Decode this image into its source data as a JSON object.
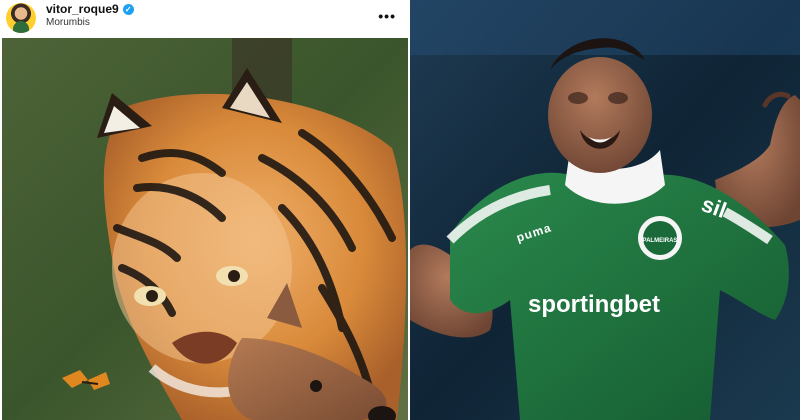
{
  "post": {
    "username": "vitor_roque9",
    "location": "Morumbis",
    "menu_icon": "more-horizontal-icon",
    "verified_icon": "check-icon",
    "image_subject": "tiger-with-fawn"
  },
  "photo": {
    "subject": "football-player-celebrating",
    "shirt_sponsor": "sportingbet",
    "shirt_brand": "puma",
    "sleeve_text": "sil",
    "badge_text": "PALMEIRAS"
  },
  "colors": {
    "verified_blue": "#1da1f2",
    "kit_green": "#1f6b3a",
    "tiger_orange": "#d98a3a"
  }
}
